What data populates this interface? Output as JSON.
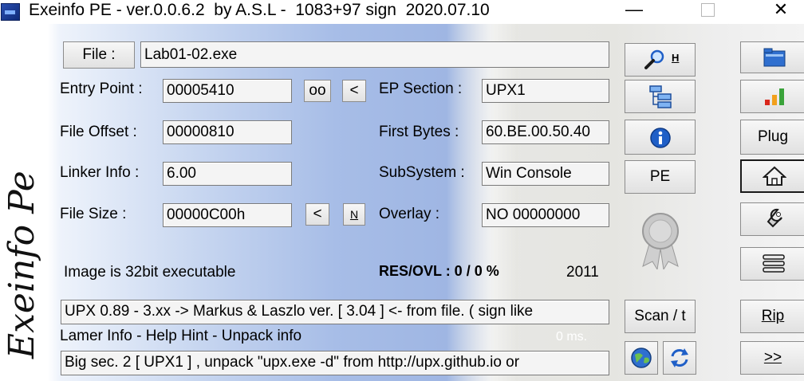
{
  "window": {
    "title": "Exeinfo PE - ver.0.0.6.2  by A.S.L -  1083+97 sign  2020.07.10",
    "minimize": "—",
    "close": "✕"
  },
  "side_logo_text": "Exeinfo Pe",
  "file": {
    "button_label": "File :",
    "path": "Lab01-02.exe"
  },
  "entry_point": {
    "label": "Entry Point :",
    "value": "00005410",
    "oo_button": "oo",
    "prev_button": "<"
  },
  "ep_section": {
    "label": "EP Section :",
    "value": "UPX1"
  },
  "file_offset": {
    "label": "File Offset :",
    "value": "00000810"
  },
  "first_bytes": {
    "label": "First Bytes :",
    "value": "60.BE.00.50.40"
  },
  "linker_info": {
    "label": "Linker Info :",
    "value": "6.00"
  },
  "subsystem": {
    "label": "SubSystem :",
    "value": "Win Console"
  },
  "file_size": {
    "label": "File Size :",
    "value": "00000C00h",
    "prev_button": "<",
    "n_button": "N"
  },
  "overlay": {
    "label": "Overlay :",
    "value": "NO   00000000"
  },
  "image_info": "Image is 32bit executable",
  "res_ovl": "RES/OVL : 0 / 0 %",
  "year": "2011",
  "detection": "UPX 0.89 - 3.xx -> Markus & Laszlo ver. [ 3.04 ] <- from file. ( sign like",
  "lamer_info": "Lamer Info - Help Hint - Unpack info",
  "time_ms": "0 ms.",
  "hint": "Big sec. 2 [ UPX1 ] , unpack \"upx.exe -d\"  from  http://upx.github.io or",
  "mid_buttons": {
    "search_h": "H",
    "pe": "PE",
    "scan": "Scan / t"
  },
  "right_buttons": {
    "plug": "Plug",
    "rip": "Rip",
    "next": ">>"
  },
  "colors": {
    "accent_blue": "#1f5fc7",
    "bar_red": "#d9261c",
    "bar_orange": "#f2a01c",
    "bar_green": "#3aa33a"
  }
}
